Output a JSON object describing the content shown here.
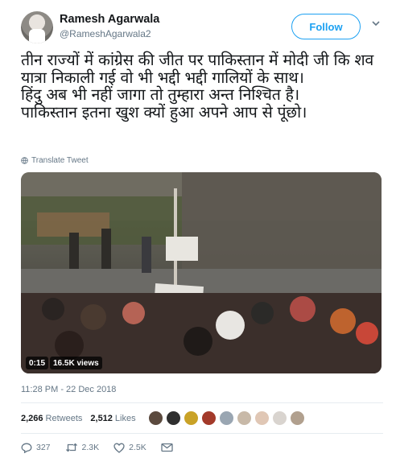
{
  "user": {
    "display_name": "Ramesh Agarwala",
    "handle": "@RameshAgarwala2"
  },
  "follow_label": "Follow",
  "tweet_text": "तीन राज्यों में कांग्रेस की जीत पर पाकिस्तान में मोदी जी कि शव यात्रा निकाली गई वो भी भद्दी भद्दी गालियों के साथ।\nहिंदु अब भी नहीं जागा तो तुम्हारा अन्त निश्चित है।\nपाकिस्तान इतना खुश क्यों हुआ अपने आप से पूंछो।",
  "translate_label": "Translate Tweet",
  "video": {
    "time": "0:15",
    "views": "16.5K views"
  },
  "timestamp": "11:28 PM - 22 Dec 2018",
  "stats": {
    "retweets_count": "2,266",
    "retweets_label": "Retweets",
    "likes_count": "2,512",
    "likes_label": "Likes"
  },
  "liker_avatar_colors": [
    "#5b4a3e",
    "#2f2f2f",
    "#c9a227",
    "#a33a2a",
    "#9aa6b2",
    "#c8b9a8",
    "#e0c7b5",
    "#d9d4cf",
    "#b1a08e"
  ],
  "actions": {
    "replies": "327",
    "retweets": "2.3K",
    "likes": "2.5K"
  },
  "colors": {
    "accent": "#1da1f2",
    "secondary_text": "#657786",
    "primary_text": "#14171a"
  }
}
